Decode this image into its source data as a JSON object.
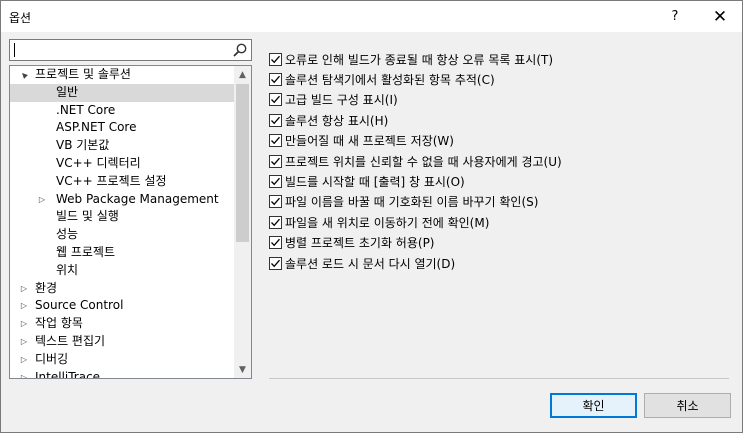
{
  "window": {
    "title": "옵션",
    "help_label": "?",
    "close_label": "✕"
  },
  "search": {
    "value": "",
    "placeholder": ""
  },
  "tree": {
    "items": [
      {
        "label": "프로젝트 및 솔루션",
        "indent": 0,
        "arrow": "▲",
        "selected": false
      },
      {
        "label": "일반",
        "indent": 1,
        "arrow": "",
        "selected": true
      },
      {
        "label": ".NET Core",
        "indent": 1,
        "arrow": "",
        "selected": false
      },
      {
        "label": "ASP.NET Core",
        "indent": 1,
        "arrow": "",
        "selected": false
      },
      {
        "label": "VB 기본값",
        "indent": 1,
        "arrow": "",
        "selected": false
      },
      {
        "label": "VC++ 디렉터리",
        "indent": 1,
        "arrow": "",
        "selected": false
      },
      {
        "label": "VC++ 프로젝트 설정",
        "indent": 1,
        "arrow": "",
        "selected": false
      },
      {
        "label": "Web Package Management",
        "indent": 1,
        "arrow": "▷",
        "selected": false
      },
      {
        "label": "빌드 및 실행",
        "indent": 1,
        "arrow": "",
        "selected": false
      },
      {
        "label": "성능",
        "indent": 1,
        "arrow": "",
        "selected": false
      },
      {
        "label": "웹 프로젝트",
        "indent": 1,
        "arrow": "",
        "selected": false
      },
      {
        "label": "위치",
        "indent": 1,
        "arrow": "",
        "selected": false
      },
      {
        "label": "환경",
        "indent": 0,
        "arrow": "▷",
        "selected": false
      },
      {
        "label": "Source Control",
        "indent": 0,
        "arrow": "▷",
        "selected": false
      },
      {
        "label": "작업 항목",
        "indent": 0,
        "arrow": "▷",
        "selected": false
      },
      {
        "label": "텍스트 편집기",
        "indent": 0,
        "arrow": "▷",
        "selected": false
      },
      {
        "label": "디버깅",
        "indent": 0,
        "arrow": "▷",
        "selected": false
      },
      {
        "label": "IntelliTrace",
        "indent": 0,
        "arrow": "▷",
        "selected": false
      }
    ]
  },
  "options": [
    {
      "label": "오류로 인해 빌드가 종료될 때 항상 오류 목록 표시(T)",
      "checked": true
    },
    {
      "label": "솔루션 탐색기에서 활성화된 항목 추적(C)",
      "checked": true
    },
    {
      "label": "고급 빌드 구성 표시(I)",
      "checked": true
    },
    {
      "label": "솔루션 항상 표시(H)",
      "checked": true
    },
    {
      "label": "만들어질 때 새 프로젝트 저장(W)",
      "checked": true
    },
    {
      "label": "프로젝트 위치를 신뢰할 수 없을 때 사용자에게 경고(U)",
      "checked": true
    },
    {
      "label": "빌드를 시작할 때 [출력] 창 표시(O)",
      "checked": true
    },
    {
      "label": "파일 이름을 바꿀 때 기호화된 이름 바꾸기 확인(S)",
      "checked": true
    },
    {
      "label": "파일을 새 위치로 이동하기 전에 확인(M)",
      "checked": true
    },
    {
      "label": "병렬 프로젝트 초기화 허용(P)",
      "checked": true
    },
    {
      "label": "솔루션 로드 시 문서 다시 열기(D)",
      "checked": true
    }
  ],
  "buttons": {
    "ok": "확인",
    "cancel": "취소"
  },
  "colors": {
    "accent": "#0078d7",
    "selected_bg": "#d9d9d9"
  }
}
